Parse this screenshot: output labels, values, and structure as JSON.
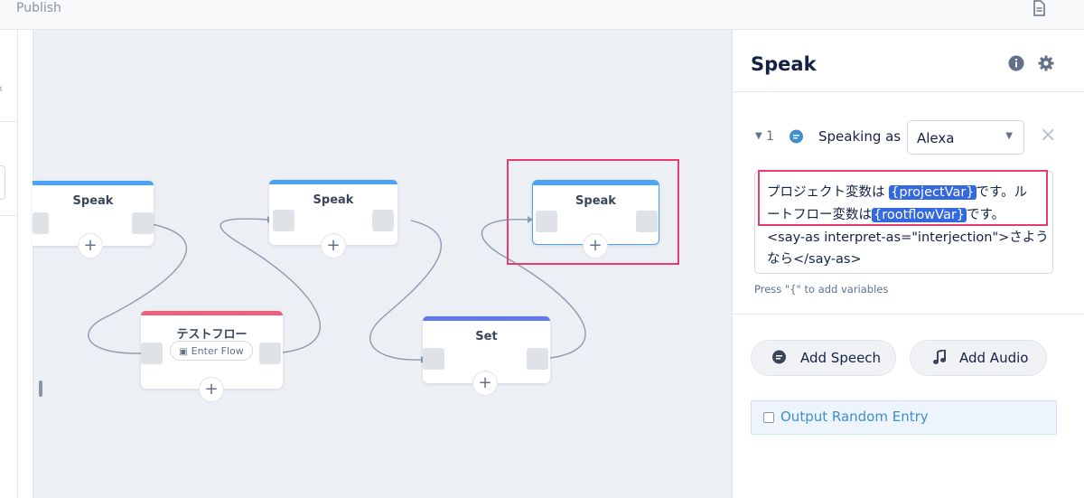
{
  "topbar": {
    "publish_label": "Publish",
    "doc_icon": "document-icon"
  },
  "canvas": {
    "nodes": [
      {
        "title": "Speak",
        "color": "#4aa3f5"
      },
      {
        "title": "Speak",
        "color": "#4aa3f5"
      },
      {
        "title": "Speak",
        "color": "#4aa3f5"
      },
      {
        "title": "テストフロー",
        "color": "#ec5f7a",
        "enter_flow_label": "Enter Flow"
      },
      {
        "title": "Set",
        "color": "#5f7ae8"
      }
    ],
    "add_symbol": "+"
  },
  "panel": {
    "title": "Speak",
    "entry_number": "1",
    "speaking_as_label": "Speaking as",
    "voice_value": "Alexa",
    "text_lines": {
      "line1_prefix": "プロジェクト変数は ",
      "var1": "{projectVar}",
      "line1_suffix": "です。ル",
      "line2_prefix": "ートフロー変数は",
      "var2": "{rootflowVar}",
      "line2_suffix": "です。",
      "line3": "<say-as interpret-as=\"interjection\">さよう",
      "line4": "なら</say-as>"
    },
    "hint": "Press \"{\" to add variables",
    "add_speech_label": "Add Speech",
    "add_audio_label": "Add Audio",
    "output_random_label": "Output Random Entry"
  },
  "colors": {
    "highlight": "#ea3b6e",
    "variable_chip": "#3468e0",
    "link": "#3e8ed0"
  }
}
